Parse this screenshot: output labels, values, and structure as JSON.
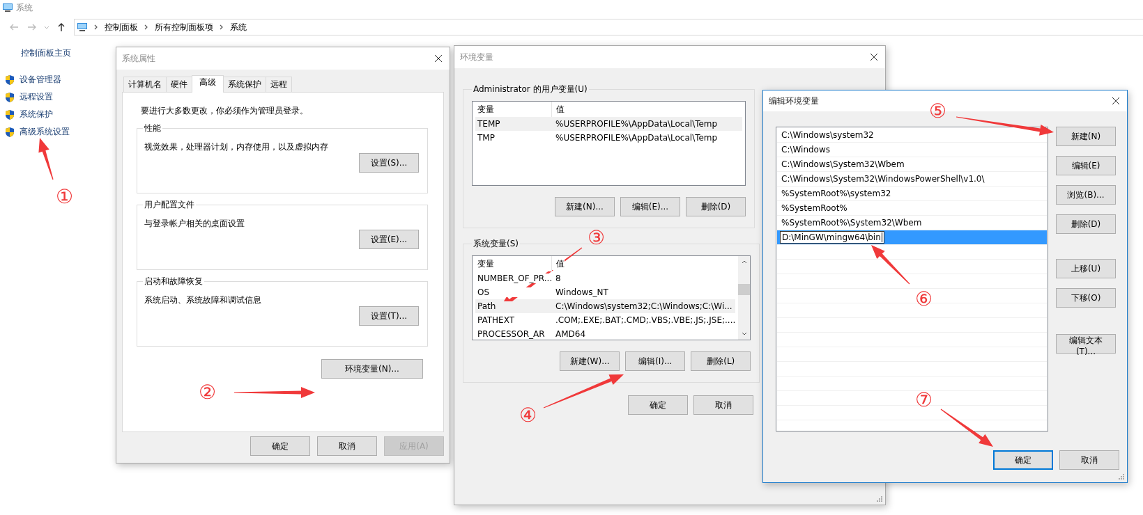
{
  "explorer": {
    "title": "系统",
    "breadcrumb": [
      "控制面板",
      "所有控制面板项",
      "系统"
    ],
    "sidebar": {
      "home": "控制面板主页",
      "items": [
        "设备管理器",
        "远程设置",
        "系统保护",
        "高级系统设置"
      ]
    }
  },
  "system_properties": {
    "title": "系统属性",
    "tabs": [
      {
        "label": "计算机名",
        "selected": false
      },
      {
        "label": "硬件",
        "selected": false
      },
      {
        "label": "高级",
        "selected": true
      },
      {
        "label": "系统保护",
        "selected": false
      },
      {
        "label": "远程",
        "selected": false
      }
    ],
    "notice": "要进行大多数更改，你必须作为管理员登录。",
    "groups": [
      {
        "title": "性能",
        "description": "视觉效果，处理器计划，内存使用，以及虚拟内存",
        "button": "设置(S)..."
      },
      {
        "title": "用户配置文件",
        "description": "与登录帐户相关的桌面设置",
        "button": "设置(E)..."
      },
      {
        "title": "启动和故障恢复",
        "description": "系统启动、系统故障和调试信息",
        "button": "设置(T)..."
      }
    ],
    "env_button": "环境变量(N)...",
    "buttons": [
      {
        "label": "确定",
        "disabled": false
      },
      {
        "label": "取消",
        "disabled": false
      },
      {
        "label": "应用(A)",
        "disabled": true
      }
    ]
  },
  "environment_variables": {
    "title": "环境变量",
    "user_vars": {
      "title": "Administrator 的用户变量(U)",
      "columns": [
        "变量",
        "值"
      ],
      "rows": [
        {
          "name": "TEMP",
          "value": "%USERPROFILE%\\AppData\\Local\\Temp",
          "selected": true
        },
        {
          "name": "TMP",
          "value": "%USERPROFILE%\\AppData\\Local\\Temp",
          "selected": false
        }
      ],
      "buttons": [
        "新建(N)...",
        "编辑(E)...",
        "删除(D)"
      ]
    },
    "system_vars": {
      "title": "系统变量(S)",
      "columns": [
        "变量",
        "值"
      ],
      "rows": [
        {
          "name": "NUMBER_OF_PR...",
          "value": "8",
          "selected": false
        },
        {
          "name": "OS",
          "value": "Windows_NT",
          "selected": false
        },
        {
          "name": "Path",
          "value": "C:\\Windows\\system32;C:\\Windows;C:\\Wi...",
          "selected": true
        },
        {
          "name": "PATHEXT",
          "value": ".COM;.EXE;.BAT;.CMD;.VBS;.VBE;.JS;.JSE;....",
          "selected": false
        },
        {
          "name": "PROCESSOR_AR",
          "value": "AMD64",
          "selected": false
        }
      ],
      "buttons": [
        "新建(W)...",
        "编辑(I)...",
        "删除(L)"
      ]
    },
    "buttons": [
      "确定",
      "取消"
    ]
  },
  "edit_variable": {
    "title": "编辑环境变量",
    "entries": [
      {
        "value": "C:\\Windows\\system32",
        "selected": false
      },
      {
        "value": "C:\\Windows",
        "selected": false
      },
      {
        "value": "C:\\Windows\\System32\\Wbem",
        "selected": false
      },
      {
        "value": "C:\\Windows\\System32\\WindowsPowerShell\\v1.0\\",
        "selected": false
      },
      {
        "value": "%SystemRoot%\\system32",
        "selected": false
      },
      {
        "value": "%SystemRoot%",
        "selected": false
      },
      {
        "value": "%SystemRoot%\\System32\\Wbem",
        "selected": false
      },
      {
        "value": "D:\\MinGW\\mingw64\\bin",
        "selected": true
      }
    ],
    "side_buttons": [
      "新建(N)",
      "编辑(E)",
      "浏览(B)...",
      "删除(D)",
      "上移(U)",
      "下移(O)",
      "编辑文本(T)..."
    ],
    "buttons": [
      {
        "label": "确定",
        "default": true
      },
      {
        "label": "取消",
        "default": false
      }
    ]
  },
  "annotations": [
    "①",
    "②",
    "③",
    "④",
    "⑤",
    "⑥",
    "⑦"
  ]
}
